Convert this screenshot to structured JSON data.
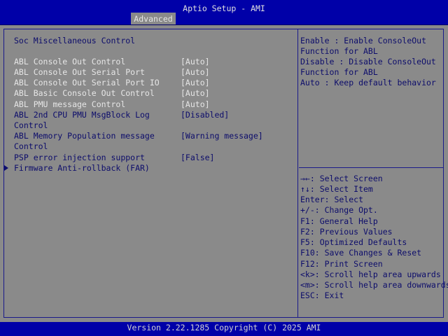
{
  "window": {
    "title": "Aptio Setup - AMI",
    "tab": "Advanced"
  },
  "section_title": "Soc Miscellaneous Control",
  "settings": [
    {
      "label": "ABL Console Out Control",
      "value": "[Auto]"
    },
    {
      "label": "ABL Console Out Serial Port",
      "value": "[Auto]"
    },
    {
      "label": "ABL Console Out Serial Port IO",
      "value": "[Auto]"
    },
    {
      "label": "ABL Basic Console Out Control",
      "value": "[Auto]"
    },
    {
      "label": "ABL PMU message Control",
      "value": "[Auto]"
    },
    {
      "label_line1": "ABL 2nd CPU PMU MsgBlock Log",
      "label_line2": "Control",
      "value": "[Disabled]"
    },
    {
      "label_line1": "ABL Memory Population message",
      "label_line2": "Control",
      "value": "[Warning message]"
    },
    {
      "label": "PSP error injection support",
      "value": "[False]"
    }
  ],
  "submenu": {
    "label": "Firmware Anti-rollback (FAR)"
  },
  "help_text": [
    "Enable : Enable ConsoleOut",
    "Function for ABL",
    "Disable : Disable ConsoleOut",
    "Function for ABL",
    "Auto : Keep default behavior"
  ],
  "key_help": [
    "→←: Select Screen",
    "↑↓: Select Item",
    "Enter: Select",
    "+/-: Change Opt.",
    "F1: General Help",
    "F2: Previous Values",
    "F5: Optimized Defaults",
    "F10: Save Changes & Reset",
    "F12: Print Screen",
    "<k>: Scroll help area upwards",
    "<m>: Scroll help area downwards",
    "ESC: Exit"
  ],
  "footer": "Version 2.22.1285 Copyright (C) 2025 AMI",
  "colors": {
    "header_bg": "#0000a8",
    "panel_bg": "#8a8a8a",
    "text_blue": "#0d0d6b",
    "text_white": "#e6e6e6"
  }
}
